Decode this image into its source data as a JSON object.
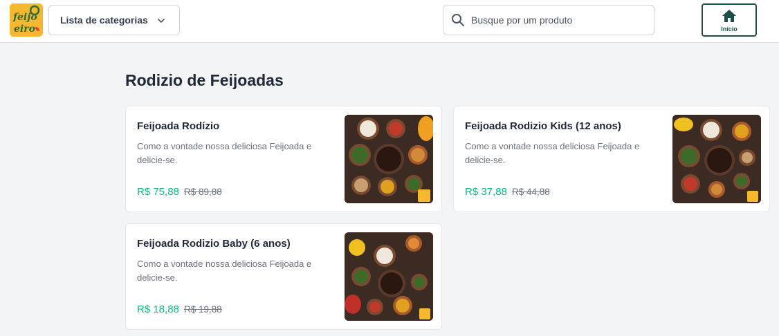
{
  "header": {
    "logo_text": "feijo eiro",
    "categories_label": "Lista de categorias",
    "search_placeholder": "Busque por um produto",
    "home_label": "Início",
    "colors": {
      "brand": "#f5b82e",
      "accent": "#1f4e4a",
      "price": "#10b981"
    },
    "icons": [
      "chevron-down-icon",
      "search-icon",
      "home-icon"
    ]
  },
  "section": {
    "title": "Rodizio de Feijoadas"
  },
  "products": [
    {
      "name": "Feijoada Rodízio",
      "description": "Como a vontade nossa deliciosa Feijoada e delicie-se.",
      "price": "R$ 75,88",
      "old_price": "R$ 89,88"
    },
    {
      "name": "Feijoada Rodizio Kids (12 anos)",
      "description": "Como a vontade nossa deliciosa Feijoada e delicie-se.",
      "price": "R$ 37,88",
      "old_price": "R$ 44,88"
    },
    {
      "name": "Feijoada Rodizio Baby (6 anos)",
      "description": "Como a vontade nossa deliciosa Feijoada e delicie-se.",
      "price": "R$ 18,88",
      "old_price": "R$ 19,88"
    }
  ]
}
